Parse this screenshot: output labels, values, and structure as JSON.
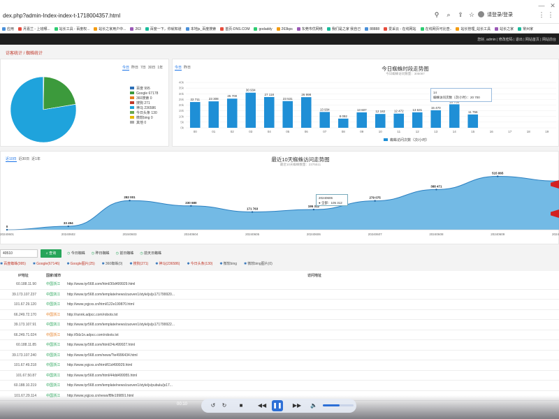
{
  "browser": {
    "url": "dex.php?admin-Index-index-t-1718004357.html",
    "signin": "请登录/登录"
  },
  "bookmarks": [
    "应用",
    "月嘉兰 - 上班哪...",
    "站长工具 - 百度权...",
    "站长之家用户中...",
    "263",
    "百度一下，你就知道",
    "本地js_百度搜索",
    "首页-DNS.COM",
    "godaddy",
    "263kps",
    "东莞市优网络",
    "我们是之家 我自己",
    "88888",
    "爱采云 - 在线网站",
    "在线网页可比查..",
    "站长管理_站长工具",
    "站长之家",
    "常州家"
  ],
  "adminbar": {
    "user": "您好, admin | 修改密码 | 退出 | 网站首页 | 网站前台"
  },
  "breadcrumb": "访客统计 / 蜘蛛统计",
  "pie_panel": {
    "tabs": [
      "今日",
      "昨日",
      "7日",
      "30日",
      "1年"
    ],
    "active_tab": 0,
    "legend": [
      {
        "label": "百度 995",
        "color": "#2c6fb7"
      },
      {
        "label": "Google 67178",
        "color": "#3c9a3c"
      },
      {
        "label": "360搜索 0",
        "color": "#e67e22"
      },
      {
        "label": "搜狗 271",
        "color": "#c0392b"
      },
      {
        "label": "神马 236586",
        "color": "#1fa3dc"
      },
      {
        "label": "今日头条 130",
        "color": "#6aa84f"
      },
      {
        "label": "微软bing 0",
        "color": "#e6b800"
      },
      {
        "label": "其他 0",
        "color": "#aaaaaa"
      }
    ]
  },
  "bar_panel": {
    "tabs": [
      "今日",
      "昨日"
    ],
    "active_tab": 0,
    "title": "今日蜘蛛时段走势图",
    "subtitle": "今日蜘蛛访问数量：305087",
    "legend": "蜘蛛访问次数（次/小时）",
    "tooltip": [
      "14",
      "蜘蛛访问次数（次/小时）：20 700"
    ]
  },
  "line_panel": {
    "tabs": [
      "近10日",
      "近30日",
      "近1年"
    ],
    "active_tab": 0,
    "title": "最近10天蜘蛛访问走势图",
    "subtitle": "最近10天蜘蛛数量：2375511",
    "tooltip": [
      "20240606",
      "● 全部：105 312"
    ]
  },
  "chart_data": [
    {
      "type": "pie",
      "categories": [
        "百度",
        "Google",
        "360搜索",
        "搜狗",
        "神马",
        "今日头条",
        "微软bing",
        "其他"
      ],
      "values": [
        995,
        67178,
        0,
        271,
        236586,
        130,
        0,
        0
      ]
    },
    {
      "type": "bar",
      "title": "今日蜘蛛时段走势图",
      "categories": [
        "00",
        "01",
        "02",
        "03",
        "04",
        "05",
        "06",
        "07",
        "08",
        "09",
        "10",
        "11",
        "12",
        "13",
        "14",
        "15",
        "16",
        "17",
        "18",
        "19"
      ],
      "values": [
        22711,
        23308,
        25700,
        30934,
        27118,
        23531,
        26998,
        13934,
        8092,
        13607,
        12182,
        12472,
        13631,
        15470,
        20700,
        11756,
        null,
        null,
        null,
        null
      ],
      "value_labels": [
        "22 711",
        "23 308",
        "25 700",
        "30 934",
        "27 118",
        "23 531",
        "26 998",
        "13 934",
        "8 092",
        "13 607",
        "12 182",
        "12 472",
        "13 631",
        "15 470",
        "20 700",
        "11 756",
        "",
        "",
        "",
        ""
      ],
      "yticks": [
        "40k",
        "35k",
        "30k",
        "25k",
        "20k",
        "15k",
        "10k",
        "5k",
        "0k"
      ],
      "ylim": [
        0,
        40000
      ]
    },
    {
      "type": "area",
      "title": "最近10天蜘蛛访问走势图",
      "categories": [
        "20240601",
        "20240602",
        "20240603",
        "20240604",
        "20240605",
        "20240606",
        "20240607",
        "20240608",
        "20240609",
        "20240610"
      ],
      "values": [
        0,
        33494,
        282001,
        230680,
        171763,
        195312,
        279075,
        388471,
        515865,
        null
      ],
      "value_labels": [
        "0",
        "33 494",
        "282 001",
        "230 680",
        "171 763",
        "195 312",
        "279 075",
        "388 471",
        "515 865",
        ""
      ],
      "ylim": [
        0,
        560000
      ]
    }
  ],
  "toolbar": {
    "search_value": "40510",
    "search_label": "查询",
    "quick": [
      "今日蜘蛛",
      "昨日蜘蛛",
      "前日蜘蛛",
      "前天日蜘蛛"
    ]
  },
  "engines": [
    {
      "label": "百度蜘蛛(995)",
      "color": "#c0392b"
    },
    {
      "label": "Google(67146)",
      "color": "#c0392b"
    },
    {
      "label": "Google图片(25)",
      "color": "#c0392b"
    },
    {
      "label": "360蜘蛛(0)",
      "color": "#555555"
    },
    {
      "label": "搜狗(271)",
      "color": "#c0392b"
    },
    {
      "label": "神马(236586)",
      "color": "#c0392b"
    },
    {
      "label": "今日头条(130)",
      "color": "#c0392b"
    },
    {
      "label": "微软bing",
      "color": "#555555"
    },
    {
      "label": "微软bing图片(0)",
      "color": "#555555"
    }
  ],
  "table": {
    "headers": [
      "IP地址",
      "国家/城市",
      "访问地址"
    ],
    "rows": [
      {
        "ip": "60.188.11.90",
        "region": "中国浙江",
        "url": "http://www.tyr568.com/html/30d499929.html"
      },
      {
        "ip": "39.173.107.237",
        "region": "中国浙江",
        "url": "http://www.tyr568.com/template/news/zuoven1/style/js/js171799920..."
      },
      {
        "ip": "101.67.29.120",
        "region": "中国浙江",
        "url": "http://www.yqjcxs.cn/html/122e199870.html"
      },
      {
        "ip": "66.249.72.170",
        "region": "中国浙江",
        "url": "http://rannk.adpcc.com/robots.txt"
      },
      {
        "ip": "39.173.107.91",
        "region": "中国浙江",
        "url": "http://www.tyr568.com/template/news/zuoven1/style/js/js171799922..."
      },
      {
        "ip": "66.249.71.024",
        "region": "中国浙江",
        "url": "http://0dz1n.adpcc.com/robots.txt"
      },
      {
        "ip": "60.188.11.85",
        "region": "中国浙江",
        "url": "http://www.tyr568.com/html/24c499927.html"
      },
      {
        "ip": "39.173.107.240",
        "region": "中国浙江",
        "url": "http://www.tyr568.com/news/?ie4996434.html"
      },
      {
        "ip": "101.67.49.218",
        "region": "中国浙江",
        "url": "http://www.yqjcxs.cn/html/61d499929.html"
      },
      {
        "ip": "101.67.50.87",
        "region": "中国浙江",
        "url": "http://www.tyr568.com/html/44dd499955.html"
      },
      {
        "ip": "60.188.10.219",
        "region": "中国浙江",
        "url": "http://www.tyr568.com/template/news/zuoven1/style/js/pubulu/js17..."
      },
      {
        "ip": "101.67.29.114",
        "region": "中国浙江",
        "url": "http://www.yqjcxs.cn/news/f8fe199891.html"
      }
    ]
  },
  "player": {
    "time": "00:10",
    "volume": 0.55
  }
}
